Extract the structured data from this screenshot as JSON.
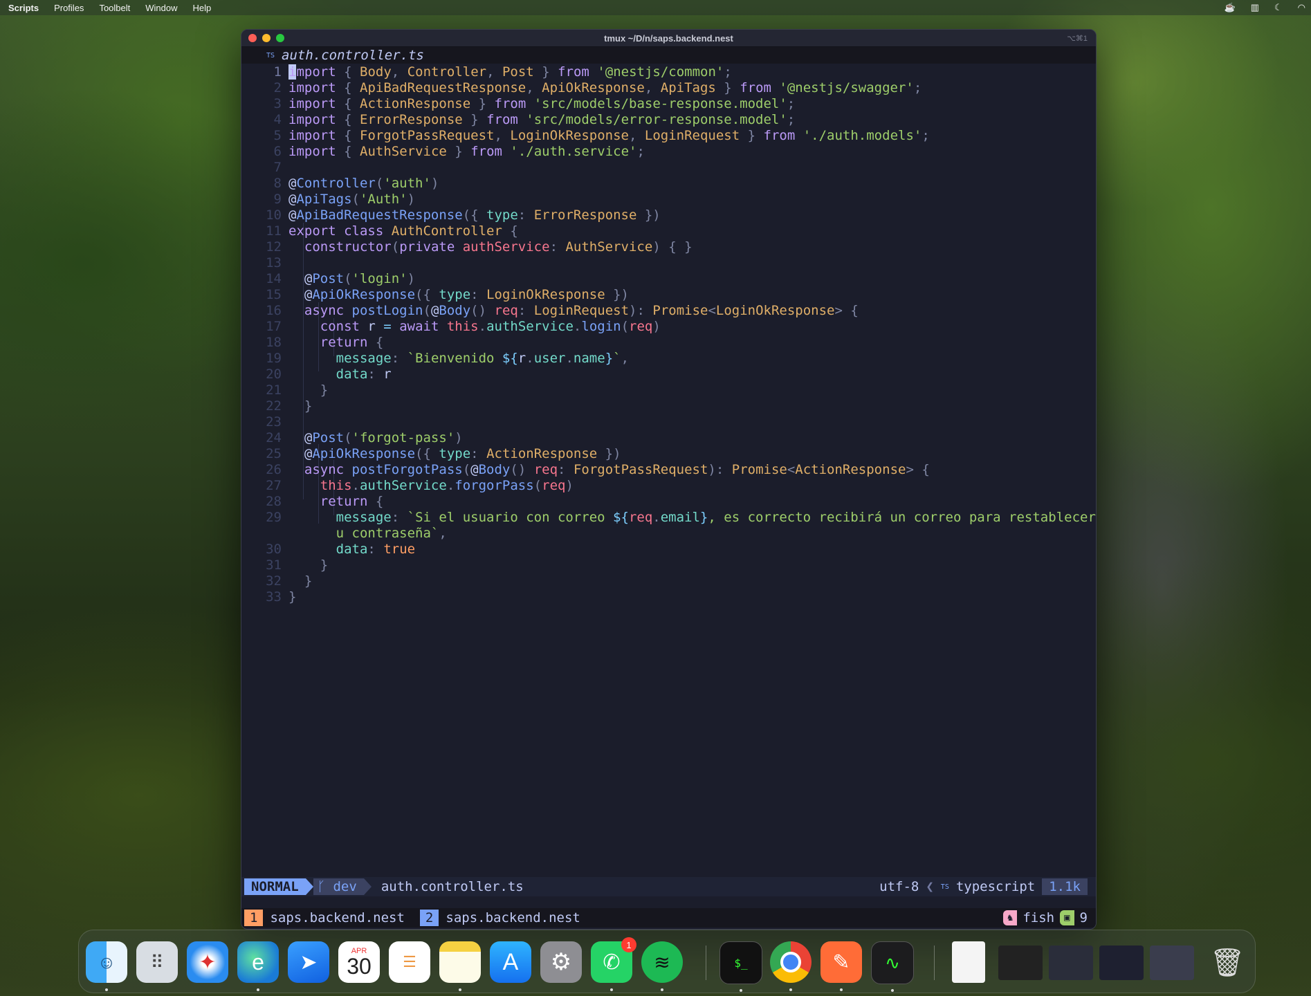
{
  "menubar": {
    "items": [
      "Scripts",
      "Profiles",
      "Toolbelt",
      "Window",
      "Help"
    ]
  },
  "window": {
    "title": "tmux ~/D/n/saps.backend.nest",
    "shortcut": "⌥⌘1"
  },
  "editor": {
    "tab_icon": "TS",
    "filename": "auth.controller.ts",
    "line_numbers": [
      "1",
      "2",
      "3",
      "4",
      "5",
      "6",
      "7",
      "8",
      "9",
      "10",
      "11",
      "12",
      "13",
      "14",
      "15",
      "16",
      "17",
      "18",
      "19",
      "20",
      "21",
      "22",
      "23",
      "24",
      "25",
      "26",
      "27",
      "28",
      "29",
      "",
      "30",
      "31",
      "32",
      "33"
    ]
  },
  "statusline": {
    "mode": "NORMAL",
    "branch": "dev",
    "file": "auth.controller.ts",
    "encoding": "utf-8",
    "filetype_icon": "TS",
    "filetype": "typescript",
    "size": "1.1k"
  },
  "tmux": {
    "windows": [
      {
        "index": "1",
        "name": "saps.backend.nest"
      },
      {
        "index": "2",
        "name": "saps.backend.nest"
      }
    ],
    "shell": "fish",
    "count": "9"
  },
  "dock": {
    "calendar_month": "APR",
    "calendar_day": "30",
    "whatsapp_badge": "1"
  },
  "colors": {
    "background": "#1b1d2b",
    "accent": "#7aa2f7",
    "string": "#9ece6a",
    "keyword": "#bb9af7",
    "type": "#e0af68"
  }
}
